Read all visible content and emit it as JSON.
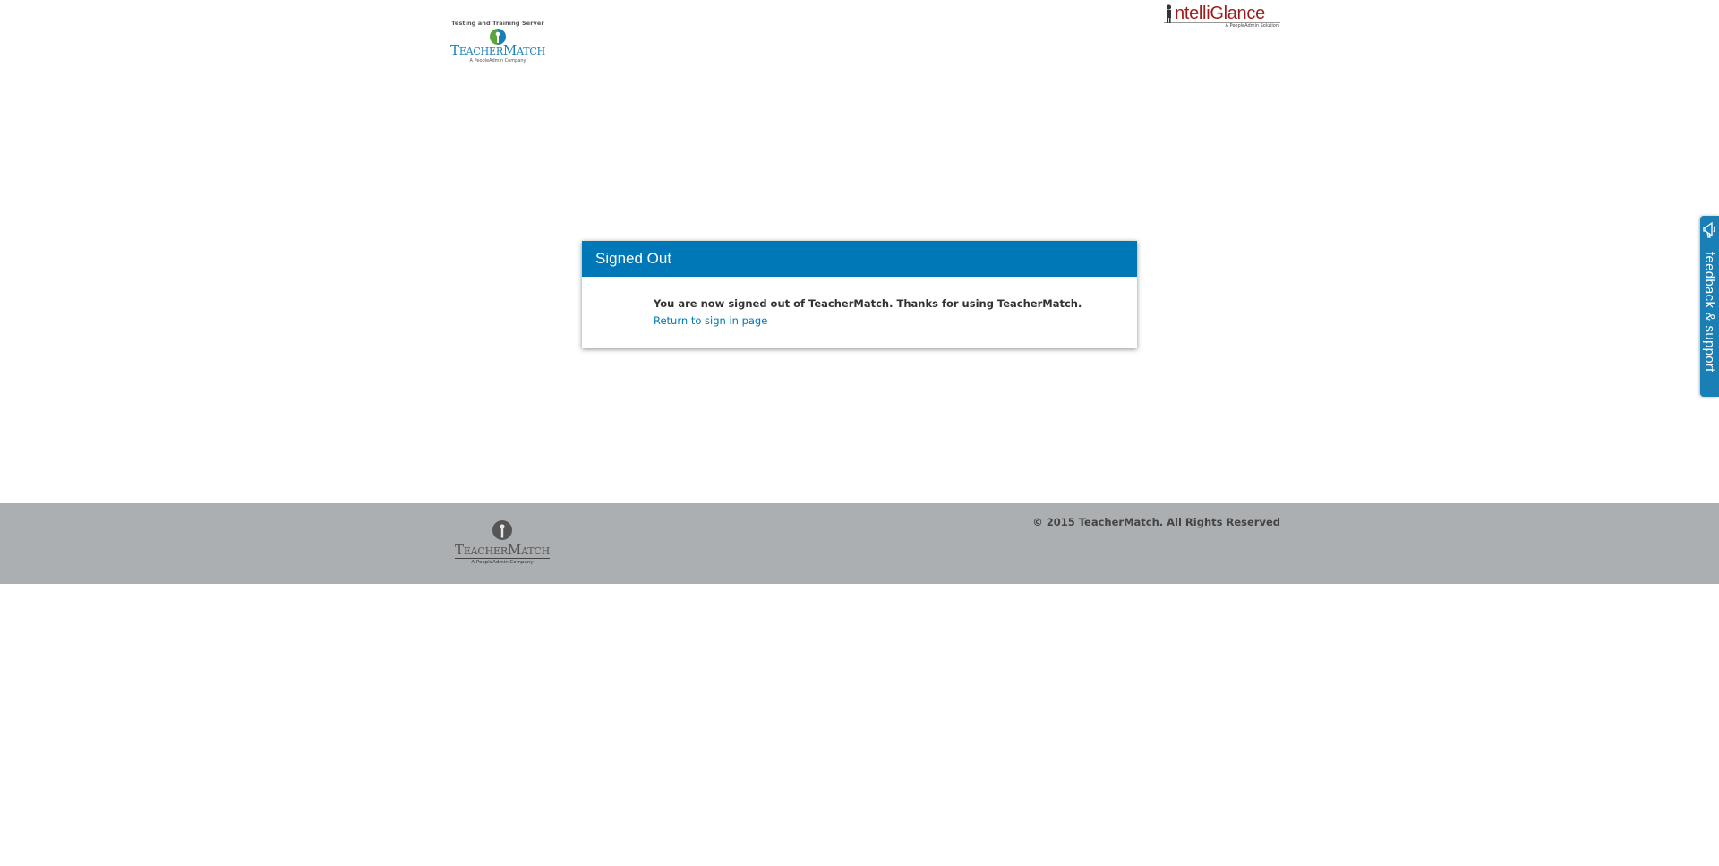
{
  "header": {
    "tm_logo": {
      "server_label": "Testing and Training Server",
      "wordmark_lead": "T",
      "wordmark_mid": "EACHER",
      "wordmark_lead2": "M",
      "wordmark_tail": "ATCH",
      "tagline": "A PeopleAdmin Company"
    },
    "ig_logo": {
      "wordmark": "ntelliGlance",
      "tagline": "A PeopleAdmin Solution"
    }
  },
  "panel": {
    "title": "Signed Out",
    "message": "You are now signed out of TeacherMatch. Thanks for using TeacherMatch.",
    "link_label": "Return to sign in page"
  },
  "feedback": {
    "label": "feedback & support",
    "icon": "megaphone-icon"
  },
  "footer": {
    "logo": {
      "wordmark_lead": "T",
      "wordmark_mid": "EACHER",
      "wordmark_lead2": "M",
      "wordmark_tail": "ATCH",
      "tagline": "A PeopleAdmin Company"
    },
    "copyright": "© 2015 TeacherMatch. All Rights Reserved"
  },
  "colors": {
    "brand_blue": "#0078b8",
    "intelliglance_red": "#9c1c1c",
    "footer_gray": "#acafb2"
  }
}
